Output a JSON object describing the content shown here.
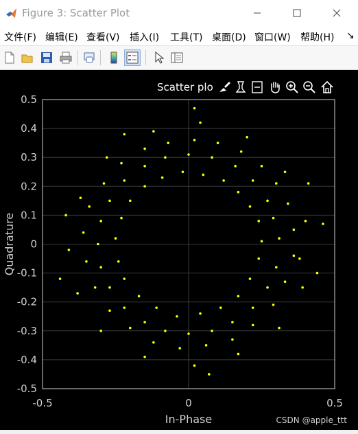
{
  "window": {
    "title": "Figure 3: Scatter Plot",
    "controls": [
      "minimize",
      "maximize",
      "close"
    ]
  },
  "menu": {
    "items": [
      "文件(F)",
      "编辑(E)",
      "查看(V)",
      "插入(I)",
      "工具(T)",
      "桌面(D)",
      "窗口(W)",
      "帮助(H)"
    ],
    "overflow": "↘"
  },
  "toolbar": {
    "buttons": [
      "new-figure-icon",
      "open-file-icon",
      "save-icon",
      "print-icon",
      "link-plot-icon",
      "insert-colorbar-icon",
      "insert-legend-icon",
      "pointer-icon",
      "property-inspector-icon"
    ]
  },
  "axes_toolbar": {
    "label": "Scatter plo",
    "tools": [
      "brush-icon",
      "data-tip-icon",
      "export-icon",
      "pan-hand-icon",
      "zoom-in-icon",
      "zoom-out-icon",
      "home-icon"
    ]
  },
  "colors": {
    "background": "#000000",
    "marker": "#ffff00",
    "axis": "#d0d0d0",
    "grid": "#3a3a3a"
  },
  "chart_data": {
    "type": "scatter",
    "title": "",
    "xlabel": "In-Phase",
    "ylabel": "Quadrature",
    "xlim": [
      -0.5,
      0.5
    ],
    "ylim": [
      -0.5,
      0.5
    ],
    "xticks": [
      "-0.5",
      "0",
      "0.5"
    ],
    "yticks": [
      "0.5",
      "0.4",
      "0.3",
      "0.2",
      "0.1",
      "0",
      "-0.1",
      "-0.2",
      "-0.3",
      "-0.4",
      "-0.5"
    ],
    "grid": true,
    "marker_color": "#ffff00",
    "series": [
      {
        "points": [
          [
            0.31,
            0.02
          ],
          [
            0.29,
            0.09
          ],
          [
            0.27,
            0.15
          ],
          [
            0.22,
            0.22
          ],
          [
            0.16,
            0.27
          ],
          [
            0.08,
            0.3
          ],
          [
            0.0,
            0.31
          ],
          [
            -0.08,
            0.3
          ],
          [
            -0.15,
            0.27
          ],
          [
            -0.22,
            0.22
          ],
          [
            -0.27,
            0.15
          ],
          [
            -0.3,
            0.08
          ],
          [
            -0.31,
            0.0
          ],
          [
            -0.3,
            -0.08
          ],
          [
            -0.27,
            -0.15
          ],
          [
            -0.22,
            -0.22
          ],
          [
            -0.15,
            -0.27
          ],
          [
            -0.08,
            -0.3
          ],
          [
            0.0,
            -0.31
          ],
          [
            0.08,
            -0.3
          ],
          [
            0.15,
            -0.27
          ],
          [
            0.22,
            -0.22
          ],
          [
            0.27,
            -0.15
          ],
          [
            0.3,
            -0.08
          ],
          [
            0.36,
            0.05
          ],
          [
            0.34,
            0.14
          ],
          [
            0.3,
            0.21
          ],
          [
            0.25,
            0.27
          ],
          [
            0.18,
            0.32
          ],
          [
            0.1,
            0.35
          ],
          [
            0.02,
            0.36
          ],
          [
            -0.07,
            0.35
          ],
          [
            -0.15,
            0.33
          ],
          [
            -0.23,
            0.28
          ],
          [
            -0.29,
            0.21
          ],
          [
            -0.34,
            0.13
          ],
          [
            -0.36,
            0.04
          ],
          [
            -0.35,
            -0.06
          ],
          [
            -0.32,
            -0.15
          ],
          [
            -0.27,
            -0.23
          ],
          [
            -0.2,
            -0.29
          ],
          [
            -0.12,
            -0.34
          ],
          [
            -0.03,
            -0.36
          ],
          [
            0.06,
            -0.35
          ],
          [
            0.15,
            -0.33
          ],
          [
            0.22,
            -0.28
          ],
          [
            0.29,
            -0.21
          ],
          [
            0.33,
            -0.13
          ],
          [
            0.36,
            -0.04
          ],
          [
            0.25,
            0.01
          ],
          [
            0.24,
            0.08
          ],
          [
            0.21,
            0.13
          ],
          [
            0.17,
            0.18
          ],
          [
            0.12,
            0.22
          ],
          [
            0.05,
            0.24
          ],
          [
            -0.02,
            0.25
          ],
          [
            -0.09,
            0.23
          ],
          [
            -0.15,
            0.2
          ],
          [
            -0.2,
            0.15
          ],
          [
            -0.23,
            0.09
          ],
          [
            -0.25,
            0.02
          ],
          [
            -0.24,
            -0.06
          ],
          [
            -0.22,
            -0.12
          ],
          [
            -0.17,
            -0.18
          ],
          [
            -0.11,
            -0.22
          ],
          [
            -0.04,
            -0.25
          ],
          [
            0.04,
            -0.24
          ],
          [
            0.11,
            -0.22
          ],
          [
            0.17,
            -0.18
          ],
          [
            0.21,
            -0.12
          ],
          [
            0.24,
            -0.05
          ],
          [
            0.4,
            0.08
          ],
          [
            0.38,
            -0.05
          ],
          [
            0.33,
            0.25
          ],
          [
            0.2,
            0.37
          ],
          [
            0.04,
            0.42
          ],
          [
            -0.12,
            0.39
          ],
          [
            -0.28,
            0.3
          ],
          [
            -0.37,
            0.16
          ],
          [
            -0.41,
            -0.02
          ],
          [
            -0.38,
            -0.17
          ],
          [
            -0.3,
            -0.3
          ],
          [
            -0.15,
            -0.39
          ],
          [
            0.02,
            -0.42
          ],
          [
            0.17,
            -0.38
          ],
          [
            0.31,
            -0.29
          ],
          [
            0.39,
            -0.15
          ],
          [
            0.46,
            0.07
          ],
          [
            0.44,
            -0.1
          ],
          [
            -0.44,
            -0.12
          ],
          [
            0.02,
            0.47
          ],
          [
            0.07,
            -0.45
          ],
          [
            -0.42,
            0.1
          ],
          [
            0.41,
            0.21
          ],
          [
            -0.22,
            0.38
          ]
        ]
      }
    ]
  },
  "watermark": "CSDN @apple_ttt"
}
